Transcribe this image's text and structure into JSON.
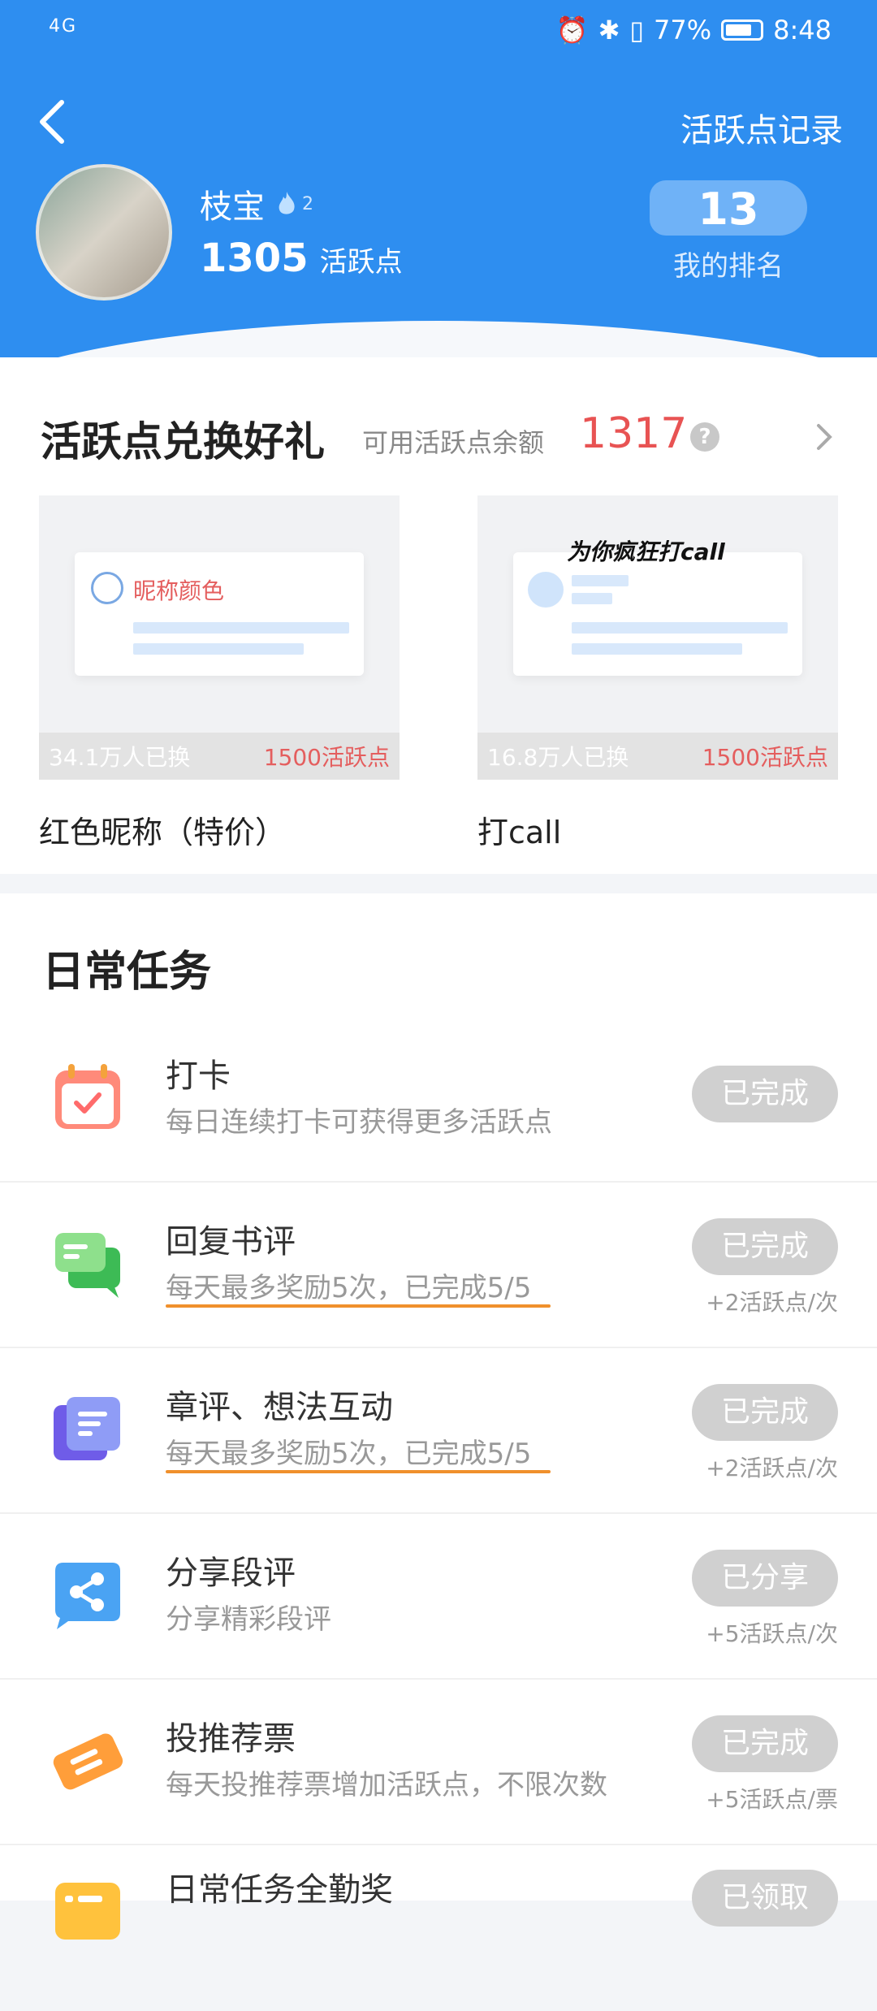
{
  "status_bar": {
    "network": "4G",
    "battery": "77%",
    "battery_level": 0.77,
    "time": "8:48"
  },
  "header": {
    "records_link": "活跃点记录",
    "user": {
      "name": "枝宝",
      "level": "2",
      "points": "1305",
      "points_label": "活跃点"
    },
    "rank": {
      "value": "13",
      "label": "我的排名"
    }
  },
  "exchange": {
    "title": "活跃点兑换好礼",
    "balance_label": "可用活跃点余额",
    "balance": "1317",
    "help": "?",
    "items": [
      {
        "name": "红色昵称（特价）",
        "preview_text": "昵称颜色",
        "swapped": "34.1万人已换",
        "cost": "1500活跃点"
      },
      {
        "name": "打call",
        "preview_text": "为你疯狂打call",
        "swapped": "16.8万人已换",
        "cost": "1500活跃点"
      }
    ]
  },
  "daily_tasks": {
    "title": "日常任务",
    "items": [
      {
        "name": "打卡",
        "desc": "每日连续打卡可获得更多活跃点",
        "button": "已完成",
        "reward": "",
        "icon": "calendar-icon"
      },
      {
        "name": "回复书评",
        "desc": "每天最多奖励5次，已完成5/5",
        "button": "已完成",
        "reward": "+2活跃点/次",
        "icon": "chat-icon"
      },
      {
        "name": "章评、想法互动",
        "desc": "每天最多奖励5次，已完成5/5",
        "button": "已完成",
        "reward": "+2活跃点/次",
        "icon": "note-icon"
      },
      {
        "name": "分享段评",
        "desc": "分享精彩段评",
        "button": "已分享",
        "reward": "+5活跃点/次",
        "icon": "share-icon"
      },
      {
        "name": "投推荐票",
        "desc": "每天投推荐票增加活跃点，不限次数",
        "button": "已完成",
        "reward": "+5活跃点/票",
        "icon": "ticket-icon"
      },
      {
        "name": "日常任务全勤奖",
        "desc": "",
        "button": "已领取",
        "reward": "",
        "icon": "award-icon"
      }
    ]
  },
  "colors": {
    "header_blue": "#2e8ef0",
    "accent_red": "#e85353",
    "underline_orange": "#f0902c",
    "done_gray": "#d0d0d0"
  }
}
